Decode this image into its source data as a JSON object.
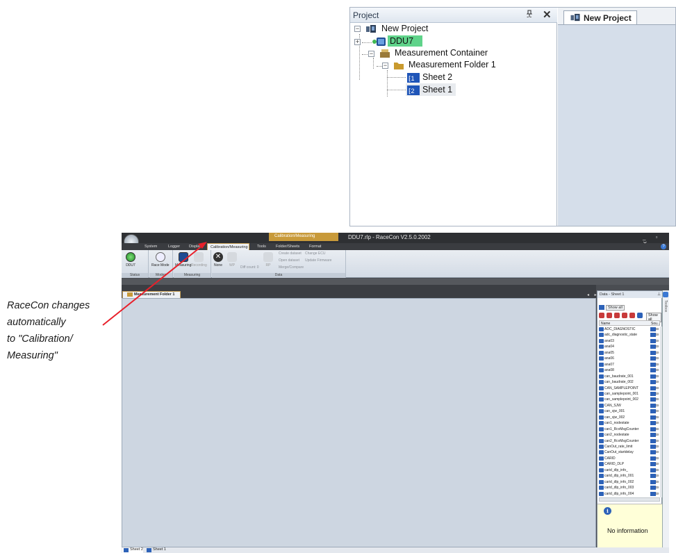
{
  "inset": {
    "project_header": "Project",
    "pin_glyph": "ᵖ",
    "close_glyph": "✕",
    "tree": [
      {
        "label": "New Project",
        "icon": "project-icon"
      },
      {
        "label": "DDU7",
        "icon": "device-icon",
        "highlight": "#5fd38a"
      },
      {
        "label": "Measurement Container",
        "icon": "container-icon"
      },
      {
        "label": "Measurement Folder 1",
        "icon": "folder-icon"
      },
      {
        "label": "Sheet 2",
        "icon": "sheet-icon"
      },
      {
        "label": "Sheet 1",
        "icon": "sheet-icon"
      }
    ],
    "editor_tab": "New Project"
  },
  "annotation": {
    "lines": [
      "RaceCon changes",
      "automatically",
      "to \"Calibration/",
      "Measuring\""
    ],
    "arrow_color": "#e8202a"
  },
  "app": {
    "title": "DDU7.rlp - RaceCon V2.5.0.2002",
    "context_tab_header": "Calibration/Measuring",
    "window_controls": "_ ▫ ✕",
    "menu_tabs": [
      "System",
      "Logger",
      "Display",
      "Calibration/Measuring",
      "Tools",
      "Folder/Sheets",
      "Format"
    ],
    "active_menu_tab": "Calibration/Measuring",
    "help_glyph": "?",
    "ribbon": {
      "groups": {
        "status": "Status",
        "modes": "Modes",
        "measuring": "Measuring",
        "data": "Data"
      },
      "buttons": {
        "ddu7": "DDU7",
        "race_mode": "Race Mode",
        "measuring": "Measuring",
        "recording": "Recording",
        "none": "None",
        "wp": "WP",
        "rp": "RP",
        "diff_count": "Diff count: 0",
        "create_dataset": "Create dataset",
        "change_ecu": "Change ECU",
        "open_dataset": "Open dataset",
        "update_firmware": "Update Firmware",
        "merge_compare": "Merge/Compare"
      }
    },
    "document_tab": "Measurement Folder 1",
    "doc_nav": "◂ ▸",
    "sheet_tabs": [
      "Sheet 2",
      "Sheet 1"
    ],
    "data_panel": {
      "header": "Data - Sheet 1",
      "pin_glyph": "ᵖ",
      "toolbox_label": "Toolbox",
      "show_all_1": "Show all",
      "show_all_2": "Show all",
      "col_name": "Name",
      "col_source": "Sou...",
      "signals": [
        "ADC_DIAGNOSTIC",
        "adc_diagnostic_state",
        "ana03",
        "ana04",
        "ana05",
        "ana06",
        "ana07",
        "ana08",
        "can_baudrate_001",
        "can_baudrate_002",
        "CAN_SAMPLEPOINT",
        "can_samplepoint_001",
        "can_samplepoint_002",
        "CAN_SJW",
        "can_sjw_001",
        "can_sjw_002",
        "can1_nodestate",
        "can1_RcvMsgCounter",
        "can2_nodestate",
        "can2_RcvMsgCounter",
        "CanOut_rate_limit",
        "CanOut_startdelay",
        "CARID",
        "CARID_DLP",
        "carid_dlp_info_",
        "carid_dlp_info_001",
        "carid_dlp_info_002",
        "carid_dlp_info_003",
        "carid_dlp_info_004"
      ],
      "source_abbrev": "DI",
      "info_text": "No information",
      "info_glyph": "i"
    }
  }
}
